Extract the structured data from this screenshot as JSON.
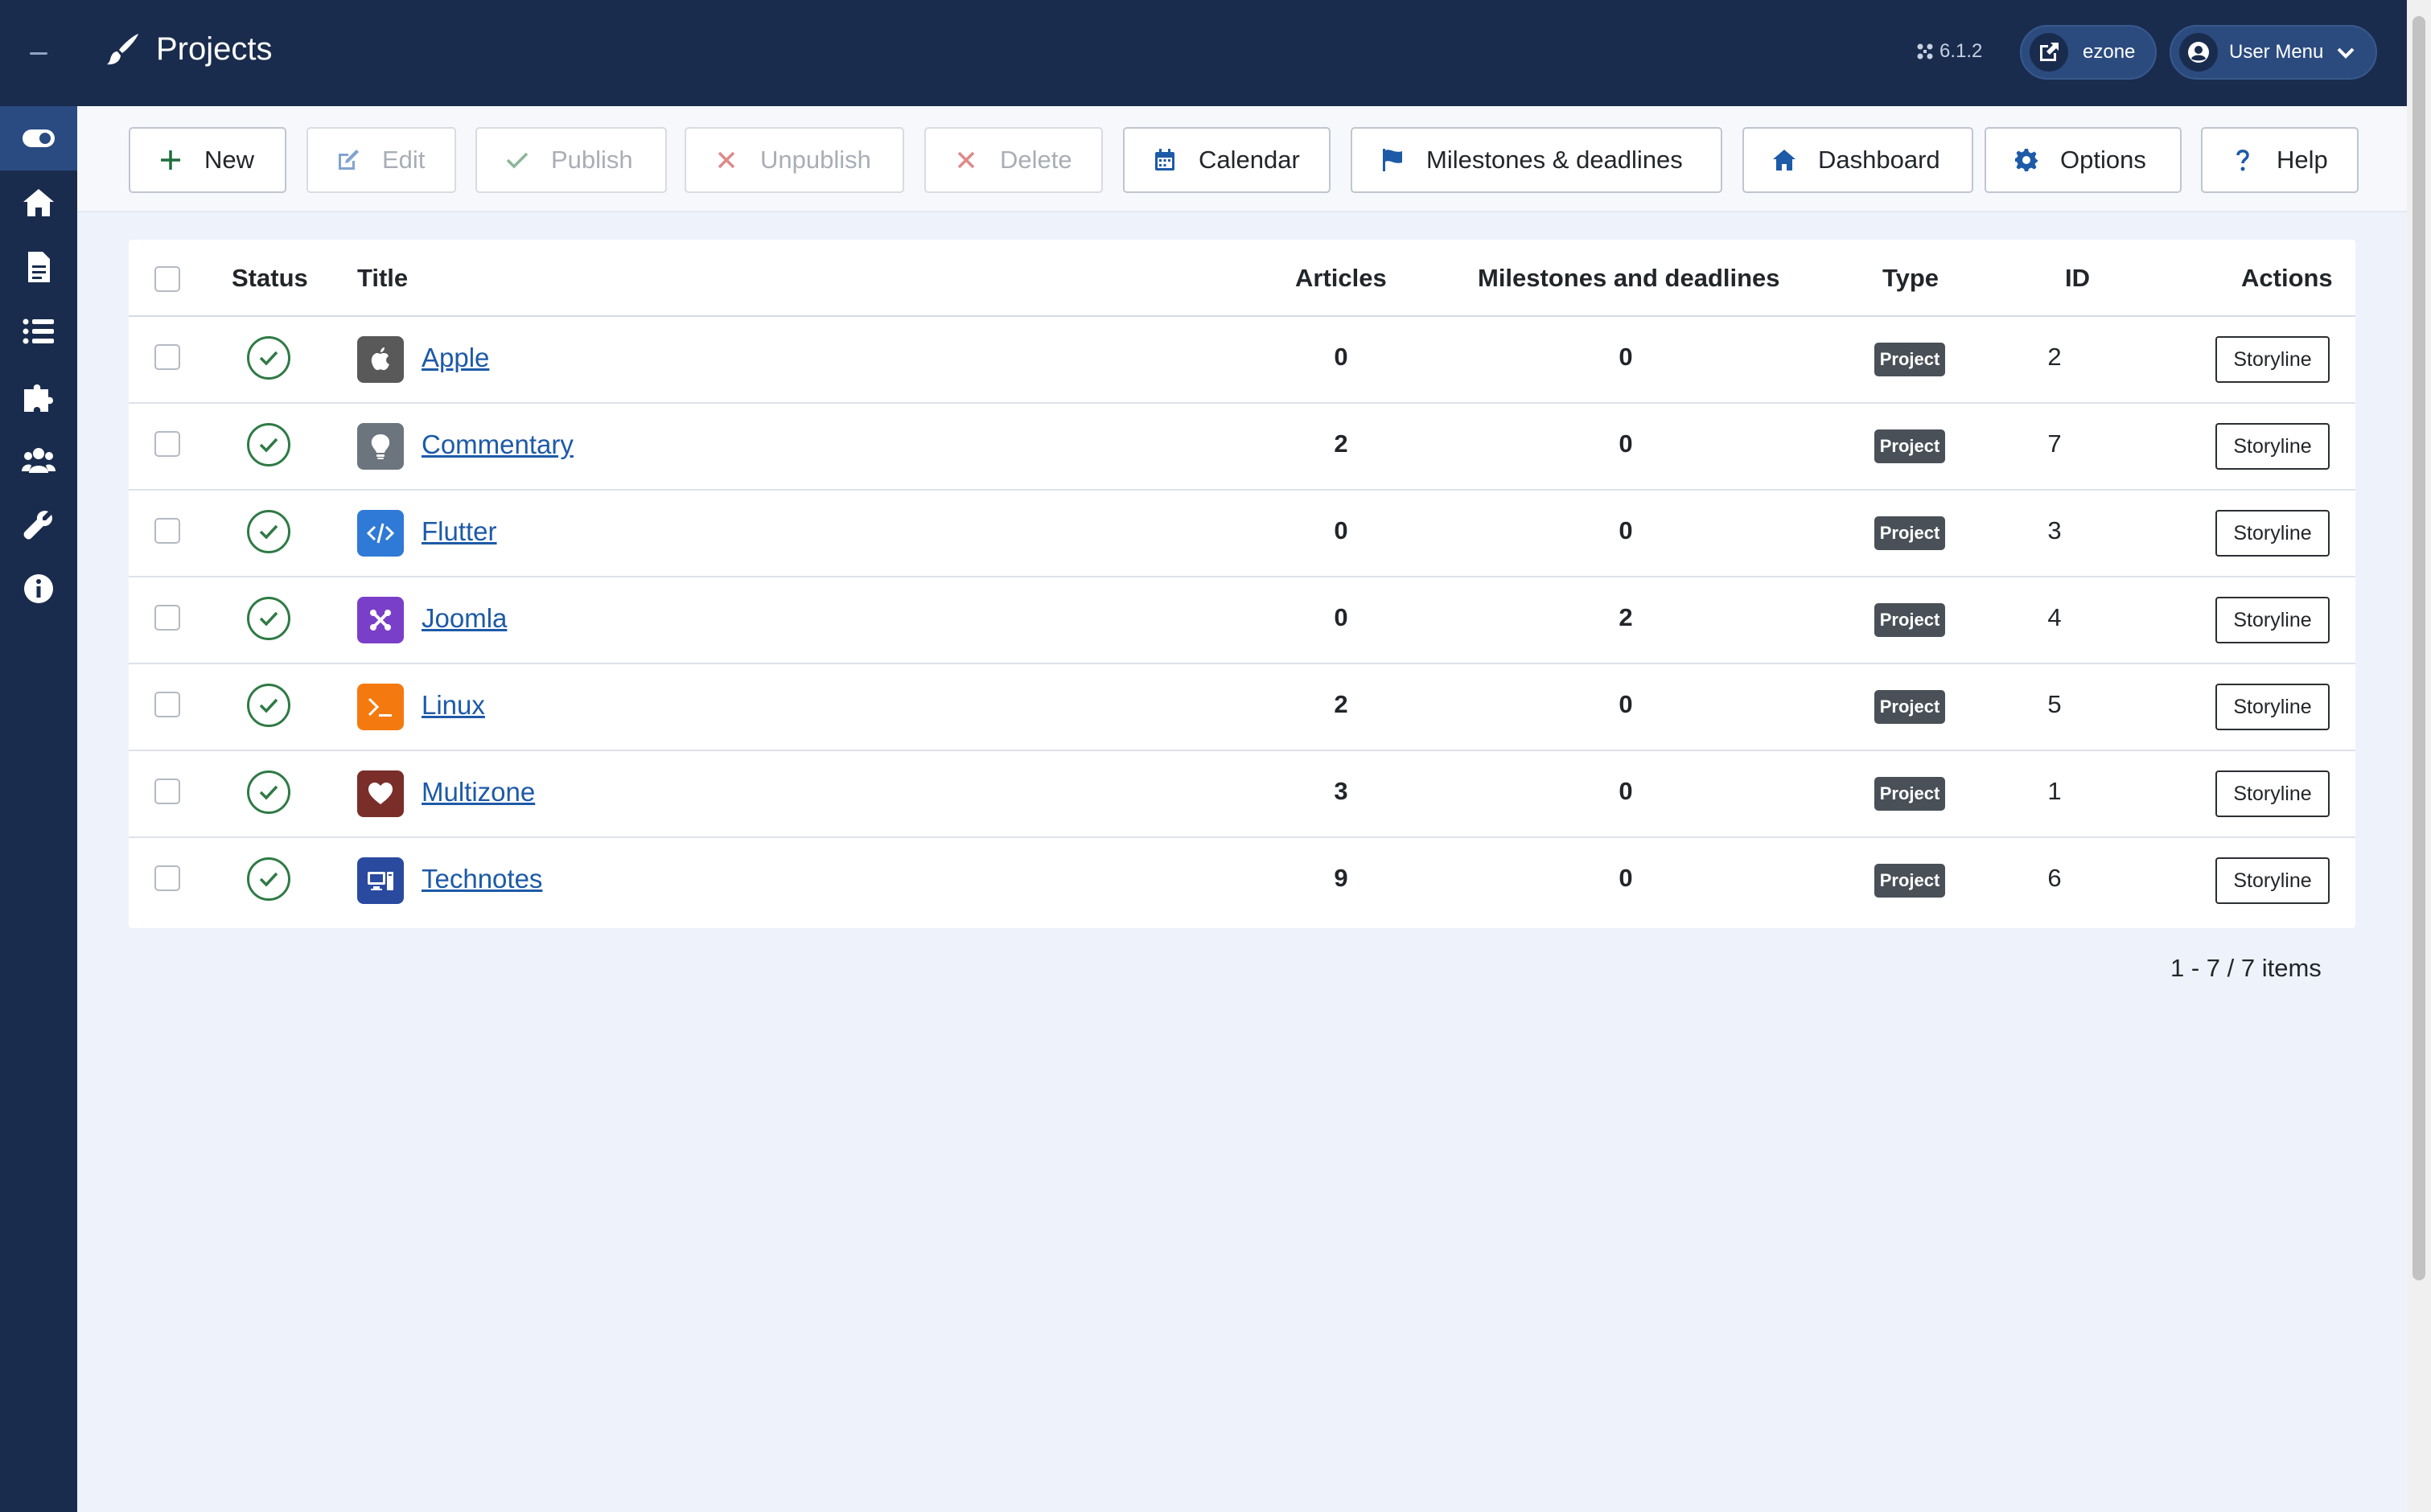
{
  "header": {
    "title": "Projects",
    "version": "6.1.2",
    "site_label": "ezone",
    "user_menu_label": "User Menu"
  },
  "sidebar": {
    "items": [
      {
        "name": "toggle-icon"
      },
      {
        "name": "home-icon"
      },
      {
        "name": "article-icon"
      },
      {
        "name": "list-icon"
      },
      {
        "name": "puzzle-icon"
      },
      {
        "name": "users-icon"
      },
      {
        "name": "wrench-icon"
      },
      {
        "name": "info-icon"
      }
    ]
  },
  "toolbar": {
    "new": "New",
    "edit": "Edit",
    "publish": "Publish",
    "unpublish": "Unpublish",
    "delete": "Delete",
    "calendar": "Calendar",
    "milestones": "Milestones & deadlines",
    "dashboard": "Dashboard",
    "options": "Options",
    "help": "Help"
  },
  "table": {
    "columns": {
      "status": "Status",
      "title": "Title",
      "articles": "Articles",
      "milestones": "Milestones and deadlines",
      "type": "Type",
      "id": "ID",
      "actions": "Actions"
    },
    "rows": [
      {
        "title": "Apple",
        "articles": "0",
        "milestones": "0",
        "type": "Project",
        "id": "2",
        "action": "Storyline",
        "icon": "apple-icon",
        "color": "#595959"
      },
      {
        "title": "Commentary",
        "articles": "2",
        "milestones": "0",
        "type": "Project",
        "id": "7",
        "action": "Storyline",
        "icon": "lightbulb-icon",
        "color": "#6c757d"
      },
      {
        "title": "Flutter",
        "articles": "0",
        "milestones": "0",
        "type": "Project",
        "id": "3",
        "action": "Storyline",
        "icon": "code-icon",
        "color": "#2f7ad6"
      },
      {
        "title": "Joomla",
        "articles": "0",
        "milestones": "2",
        "type": "Project",
        "id": "4",
        "action": "Storyline",
        "icon": "joomla-icon",
        "color": "#7a3fc8"
      },
      {
        "title": "Linux",
        "articles": "2",
        "milestones": "0",
        "type": "Project",
        "id": "5",
        "action": "Storyline",
        "icon": "terminal-icon",
        "color": "#f47a10"
      },
      {
        "title": "Multizone",
        "articles": "3",
        "milestones": "0",
        "type": "Project",
        "id": "1",
        "action": "Storyline",
        "icon": "heart-icon",
        "color": "#7a2e2a"
      },
      {
        "title": "Technotes",
        "articles": "9",
        "milestones": "0",
        "type": "Project",
        "id": "6",
        "action": "Storyline",
        "icon": "computer-icon",
        "color": "#2a4aa0"
      }
    ]
  },
  "pagination": "1 - 7 / 7 items"
}
